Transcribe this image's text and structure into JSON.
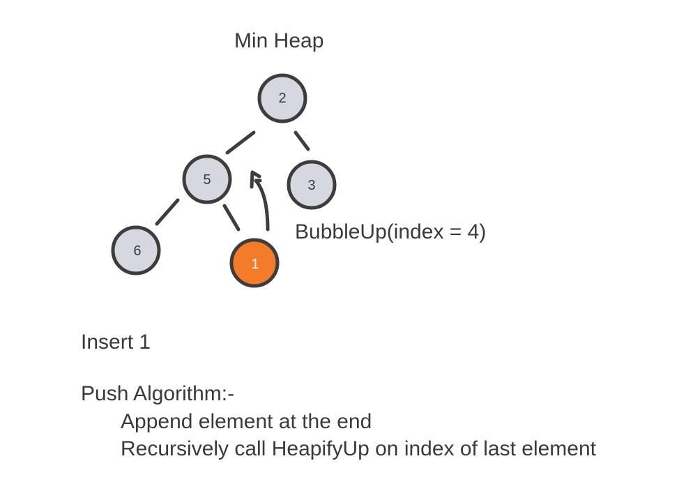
{
  "title": "Min Heap",
  "bubble_label": "BubbleUp(index = 4)",
  "insert_text": "Insert 1",
  "algorithm": {
    "title": "Push Algorithm:-",
    "steps": [
      "Append element at the end",
      "Recursively call HeapifyUp on index of last element"
    ]
  },
  "heap": {
    "nodes": [
      {
        "value": "2",
        "highlight": false
      },
      {
        "value": "5",
        "highlight": false
      },
      {
        "value": "3",
        "highlight": false
      },
      {
        "value": "6",
        "highlight": false
      },
      {
        "value": "1",
        "highlight": true
      }
    ],
    "colors": {
      "node_fill": "#d6d8df",
      "node_stroke": "#3d3d3d",
      "highlight_fill": "#f47b27",
      "edge": "#3d3d3d",
      "text": "#3a3a3a"
    }
  }
}
